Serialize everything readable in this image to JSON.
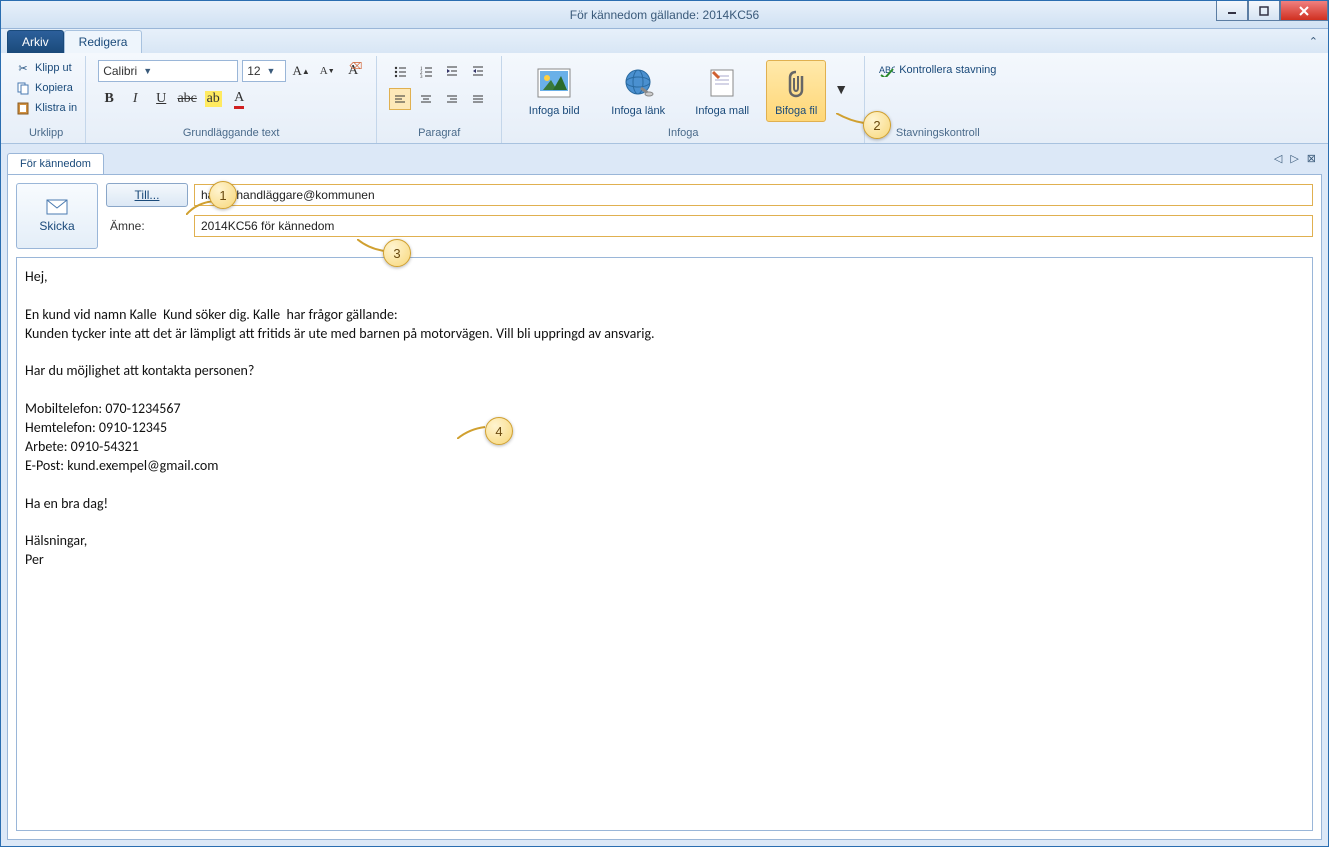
{
  "window": {
    "title": "För kännedom gällande: 2014KC56"
  },
  "menu": {
    "file": "Arkiv",
    "edit": "Redigera"
  },
  "ribbon": {
    "clipboard": {
      "cut": "Klipp ut",
      "copy": "Kopiera",
      "paste": "Klistra in",
      "group": "Urklipp"
    },
    "font": {
      "name": "Calibri",
      "size": "12",
      "group": "Grundläggande text"
    },
    "paragraph": {
      "group": "Paragraf"
    },
    "insert": {
      "image": "Infoga bild",
      "link": "Infoga länk",
      "template": "Infoga mall",
      "attach": "Bifoga fil",
      "group": "Infoga"
    },
    "spelling": {
      "check": "Kontrollera stavning",
      "group": "Stavningskontroll"
    }
  },
  "docTab": "För kännedom",
  "compose": {
    "send": "Skicka",
    "toButton": "Till...",
    "toValue": "hasse.handläggare@kommunen",
    "subjectLabel": "Ämne:",
    "subjectValue": "2014KC56 för kännedom"
  },
  "body": "Hej,\n\nEn kund vid namn Kalle  Kund söker dig. Kalle  har frågor gällande:\nKunden tycker inte att det är lämpligt att fritids är ute med barnen på motorvägen. Vill bli uppringd av ansvarig.\n\nHar du möjlighet att kontakta personen?\n\nMobiltelefon: 070-1234567\nHemtelefon: 0910-12345\nArbete: 0910-54321\nE-Post: kund.exempel@gmail.com\n\nHa en bra dag!\n\nHälsningar,\nPer",
  "callouts": {
    "c1": "1",
    "c2": "2",
    "c3": "3",
    "c4": "4"
  }
}
